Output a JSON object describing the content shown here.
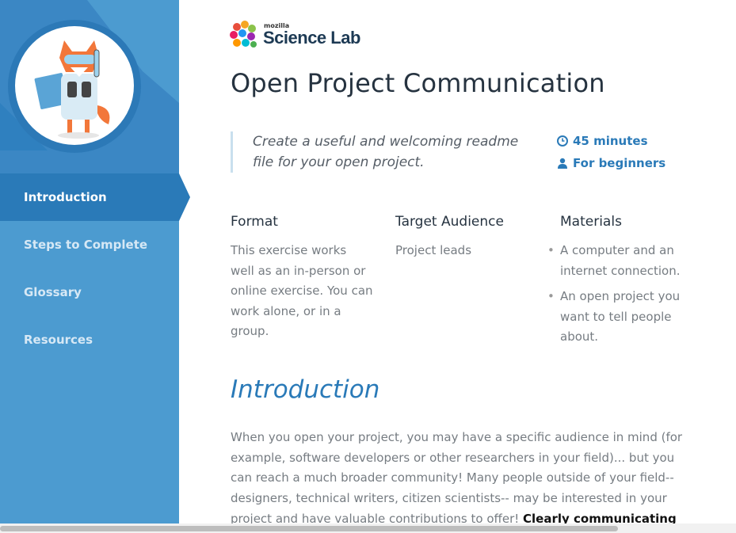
{
  "sidebar": {
    "nav": [
      {
        "label": "Introduction",
        "active": true
      },
      {
        "label": "Steps to Complete",
        "active": false
      },
      {
        "label": "Glossary",
        "active": false
      },
      {
        "label": "Resources",
        "active": false
      }
    ]
  },
  "logo": {
    "small": "mozilla",
    "name": "Science Lab"
  },
  "page_title": "Open Project Communication",
  "summary": "Create a useful and welcoming readme file for your open project.",
  "meta": {
    "duration": "45 minutes",
    "level": "For beginners"
  },
  "columns": {
    "format": {
      "heading": "Format",
      "body": "This exercise works well as an in-person or online exercise. You can work alone, or in a group."
    },
    "audience": {
      "heading": "Target Audience",
      "body": "Project leads"
    },
    "materials": {
      "heading": "Materials",
      "items": [
        "A computer and an internet connection.",
        "An open project you want to tell people about."
      ]
    }
  },
  "introduction": {
    "heading": "Introduction",
    "text": "When you open your project, you may have a specific audience in mind (for example, software developers or other researchers in your field)... but you can reach a much broader community! Many people outside of your field-- designers, technical writers, citizen scientists-- may be interested in your project and have valuable contributions to offer!",
    "bold": "Clearly communicating"
  },
  "colors": {
    "sidebar": "#4c9bd0",
    "active": "#2a7ab8",
    "accent": "#2a7ab8"
  },
  "icons": [
    "fox-scientist-illustration",
    "science-lab-logo",
    "clock-icon",
    "user-icon"
  ]
}
